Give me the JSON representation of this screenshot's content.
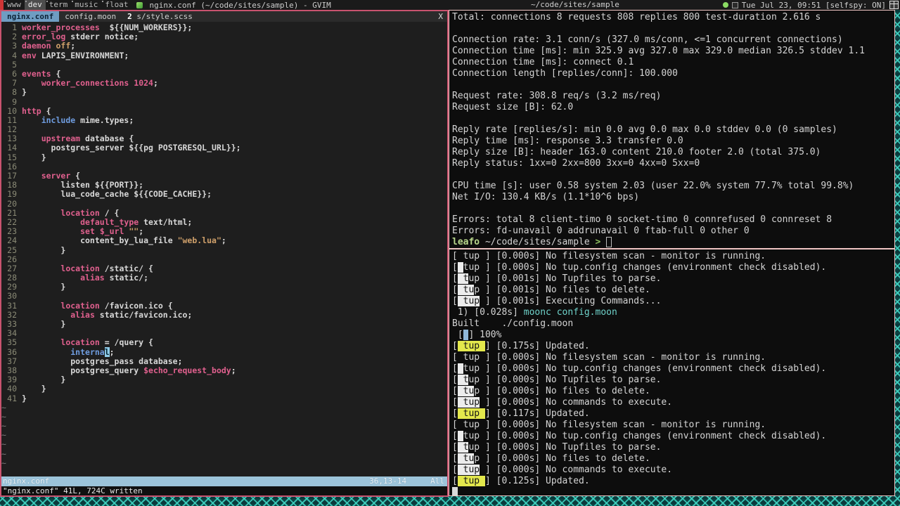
{
  "bar": {
    "tags": [
      {
        "label": "www",
        "selected": false,
        "indicator": true
      },
      {
        "label": "dev",
        "selected": true,
        "indicator": true
      },
      {
        "label": "term",
        "selected": false,
        "indicator": true
      },
      {
        "label": "music",
        "selected": false,
        "indicator": true
      },
      {
        "label": "float",
        "selected": false,
        "indicator": true
      }
    ],
    "window_title": "nginx.conf (~/code/sites/sample) - GVIM",
    "status_path": "~/code/sites/sample",
    "clock": "Tue Jul 23, 09:51 [selfspy: ON]",
    "icons": {
      "app": "gvim-icon",
      "dot": "green-dot-icon",
      "square": "hollow-square-icon",
      "grid": "grid-icon"
    },
    "accent_color": "#cf3535"
  },
  "vim": {
    "tabs": [
      {
        "label": "nginx.conf",
        "count": "",
        "active": true
      },
      {
        "label": "config.moon",
        "count": "",
        "active": false
      },
      {
        "label": "s/style.scss",
        "count": "2",
        "active": false
      }
    ],
    "close_label": "X",
    "lines": [
      {
        "n": "1",
        "seg": [
          [
            "k",
            "worker_processes"
          ],
          [
            "v",
            "  ${{NUM_WORKERS}};"
          ]
        ]
      },
      {
        "n": "2",
        "seg": [
          [
            "k",
            "error_log"
          ],
          [
            "v",
            " stderr notice;"
          ]
        ]
      },
      {
        "n": "3",
        "seg": [
          [
            "k",
            "daemon"
          ],
          [
            "v",
            " "
          ],
          [
            "s",
            "off"
          ],
          [
            "v",
            ";"
          ]
        ]
      },
      {
        "n": "4",
        "seg": [
          [
            "k",
            "env"
          ],
          [
            "v",
            " LAPIS_ENVIRONMENT;"
          ]
        ]
      },
      {
        "n": "5",
        "seg": []
      },
      {
        "n": "6",
        "seg": [
          [
            "kb",
            "events"
          ],
          [
            "v",
            " {"
          ]
        ]
      },
      {
        "n": "7",
        "seg": [
          [
            "v",
            "    "
          ],
          [
            "k",
            "worker_connections"
          ],
          [
            "v",
            " "
          ],
          [
            "k",
            "1024"
          ],
          [
            "v",
            ";"
          ]
        ]
      },
      {
        "n": "8",
        "seg": [
          [
            "v",
            "}"
          ]
        ]
      },
      {
        "n": "9",
        "seg": []
      },
      {
        "n": "10",
        "seg": [
          [
            "kb",
            "http"
          ],
          [
            "v",
            " {"
          ]
        ]
      },
      {
        "n": "11",
        "seg": [
          [
            "v",
            "    "
          ],
          [
            "b",
            "include"
          ],
          [
            "v",
            " mime.types;"
          ]
        ]
      },
      {
        "n": "12",
        "seg": []
      },
      {
        "n": "13",
        "seg": [
          [
            "v",
            "    "
          ],
          [
            "kb",
            "upstream"
          ],
          [
            "v",
            " database {"
          ]
        ]
      },
      {
        "n": "14",
        "seg": [
          [
            "v",
            "      postgres_server ${{pg POSTGRESQL_URL}};"
          ]
        ]
      },
      {
        "n": "15",
        "seg": [
          [
            "v",
            "    }"
          ]
        ]
      },
      {
        "n": "16",
        "seg": []
      },
      {
        "n": "17",
        "seg": [
          [
            "v",
            "    "
          ],
          [
            "kb",
            "server"
          ],
          [
            "v",
            " {"
          ]
        ]
      },
      {
        "n": "18",
        "seg": [
          [
            "v",
            "        listen ${{PORT}};"
          ]
        ]
      },
      {
        "n": "19",
        "seg": [
          [
            "v",
            "        lua_code_cache ${{CODE_CACHE}};"
          ]
        ]
      },
      {
        "n": "20",
        "seg": []
      },
      {
        "n": "21",
        "seg": [
          [
            "v",
            "        "
          ],
          [
            "kb",
            "location"
          ],
          [
            "v",
            " / {"
          ]
        ]
      },
      {
        "n": "22",
        "seg": [
          [
            "v",
            "            "
          ],
          [
            "k",
            "default_type"
          ],
          [
            "v",
            " text/html;"
          ]
        ]
      },
      {
        "n": "23",
        "seg": [
          [
            "v",
            "            "
          ],
          [
            "kb",
            "set"
          ],
          [
            "v",
            " "
          ],
          [
            "k",
            "$_url"
          ],
          [
            "v",
            " "
          ],
          [
            "s",
            "\"\""
          ],
          [
            "v",
            ";"
          ]
        ]
      },
      {
        "n": "24",
        "seg": [
          [
            "v",
            "            content_by_lua_file "
          ],
          [
            "s",
            "\"web.lua\""
          ],
          [
            "v",
            ";"
          ]
        ]
      },
      {
        "n": "25",
        "seg": [
          [
            "v",
            "        }"
          ]
        ]
      },
      {
        "n": "26",
        "seg": []
      },
      {
        "n": "27",
        "seg": [
          [
            "v",
            "        "
          ],
          [
            "kb",
            "location"
          ],
          [
            "v",
            " /static/ {"
          ]
        ]
      },
      {
        "n": "28",
        "seg": [
          [
            "v",
            "            "
          ],
          [
            "k",
            "alias"
          ],
          [
            "v",
            " static/;"
          ]
        ]
      },
      {
        "n": "29",
        "seg": [
          [
            "v",
            "        }"
          ]
        ]
      },
      {
        "n": "30",
        "seg": []
      },
      {
        "n": "31",
        "seg": [
          [
            "v",
            "        "
          ],
          [
            "kb",
            "location"
          ],
          [
            "v",
            " /favicon.ico {"
          ]
        ]
      },
      {
        "n": "32",
        "seg": [
          [
            "v",
            "          "
          ],
          [
            "k",
            "alias"
          ],
          [
            "v",
            " static/favicon.ico;"
          ]
        ]
      },
      {
        "n": "33",
        "seg": [
          [
            "v",
            "        }"
          ]
        ]
      },
      {
        "n": "34",
        "seg": []
      },
      {
        "n": "35",
        "seg": [
          [
            "v",
            "        "
          ],
          [
            "kb",
            "location"
          ],
          [
            "v",
            " = /query {"
          ]
        ]
      },
      {
        "n": "36",
        "seg": [
          [
            "v",
            "          "
          ],
          [
            "b",
            "interna"
          ],
          [
            "cur",
            "l"
          ],
          [
            "v",
            ";"
          ]
        ]
      },
      {
        "n": "37",
        "seg": [
          [
            "v",
            "          postgres_pass database;"
          ]
        ]
      },
      {
        "n": "38",
        "seg": [
          [
            "v",
            "          postgres_query "
          ],
          [
            "k",
            "$echo_request_body"
          ],
          [
            "v",
            ";"
          ]
        ]
      },
      {
        "n": "39",
        "seg": [
          [
            "v",
            "        }"
          ]
        ]
      },
      {
        "n": "40",
        "seg": [
          [
            "v",
            "    }"
          ]
        ]
      },
      {
        "n": "41",
        "seg": [
          [
            "v",
            "}"
          ]
        ]
      }
    ],
    "tilde_rows": 7,
    "tilde_char": "~",
    "statusline": {
      "file": "nginx.conf",
      "position": "36,13-14",
      "scroll": "All"
    },
    "cmdline": "\"nginx.conf\" 41L, 724C written"
  },
  "term_top": {
    "lines": [
      {
        "seg": [
          [
            "w",
            "Total: connections 8 requests 808 replies 800 test-duration 2.616 s"
          ]
        ]
      },
      {
        "seg": []
      },
      {
        "seg": [
          [
            "w",
            "Connection rate: 3.1 conn/s (327.0 ms/conn, <=1 concurrent connections)"
          ]
        ]
      },
      {
        "seg": [
          [
            "w",
            "Connection time [ms]: min 325.9 avg 327.0 max 329.0 median 326.5 stddev 1.1"
          ]
        ]
      },
      {
        "seg": [
          [
            "w",
            "Connection time [ms]: connect 0.1"
          ]
        ]
      },
      {
        "seg": [
          [
            "w",
            "Connection length [replies/conn]: 100.000"
          ]
        ]
      },
      {
        "seg": []
      },
      {
        "seg": [
          [
            "w",
            "Request rate: 308.8 req/s (3.2 ms/req)"
          ]
        ]
      },
      {
        "seg": [
          [
            "w",
            "Request size [B]: 62.0"
          ]
        ]
      },
      {
        "seg": []
      },
      {
        "seg": [
          [
            "w",
            "Reply rate [replies/s]: min 0.0 avg 0.0 max 0.0 stddev 0.0 (0 samples)"
          ]
        ]
      },
      {
        "seg": [
          [
            "w",
            "Reply time [ms]: response 3.3 transfer 0.0"
          ]
        ]
      },
      {
        "seg": [
          [
            "w",
            "Reply size [B]: header 163.0 content 210.0 footer 2.0 (total 375.0)"
          ]
        ]
      },
      {
        "seg": [
          [
            "w",
            "Reply status: 1xx=0 2xx=800 3xx=0 4xx=0 5xx=0"
          ]
        ]
      },
      {
        "seg": []
      },
      {
        "seg": [
          [
            "w",
            "CPU time [s]: user 0.58 system 2.03 (user 22.0% system 77.7% total 99.8%)"
          ]
        ]
      },
      {
        "seg": [
          [
            "w",
            "Net I/O: 130.4 KB/s (1.1*10^6 bps)"
          ]
        ]
      },
      {
        "seg": []
      },
      {
        "seg": [
          [
            "w",
            "Errors: total 8 client-timo 0 socket-timo 0 connrefused 0 connreset 8"
          ]
        ]
      },
      {
        "seg": [
          [
            "w",
            "Errors: fd-unavail 0 addrunavail 0 ftab-full 0 other 0"
          ]
        ]
      },
      {
        "seg": [
          [
            "green",
            "leafo "
          ],
          [
            "w",
            "~/code/sites/sample "
          ],
          [
            "gt",
            "> "
          ],
          [
            "hcur",
            " "
          ]
        ]
      }
    ]
  },
  "term_bottom": {
    "lines": [
      {
        "seg": [
          [
            "w",
            "[ tup ] [0.000s] No filesystem scan - monitor is running."
          ]
        ]
      },
      {
        "seg": [
          [
            "w",
            "["
          ],
          [
            "hl",
            " "
          ],
          [
            "w",
            "tup ] [0.000s] No tup.config changes (environment check disabled)."
          ]
        ]
      },
      {
        "seg": [
          [
            "w",
            "["
          ],
          [
            "hl",
            " t"
          ],
          [
            "w",
            "up ] [0.001s] No Tupfiles to parse."
          ]
        ]
      },
      {
        "seg": [
          [
            "w",
            "["
          ],
          [
            "hl",
            " tu"
          ],
          [
            "w",
            "p ] [0.001s] No files to delete."
          ]
        ]
      },
      {
        "seg": [
          [
            "w",
            "["
          ],
          [
            "hl",
            " tup"
          ],
          [
            "w",
            " ] [0.001s] Executing Commands..."
          ]
        ]
      },
      {
        "seg": [
          [
            "w",
            " 1) [0.028s] "
          ],
          [
            "cy",
            "moonc config.moon"
          ]
        ]
      },
      {
        "seg": [
          [
            "w",
            "Built    ./config.moon"
          ]
        ]
      },
      {
        "seg": [
          [
            "w",
            " ["
          ],
          [
            "bb",
            " "
          ],
          [
            "w",
            "] 100%"
          ]
        ]
      },
      {
        "seg": [
          [
            "w",
            "["
          ],
          [
            "yl",
            " tup "
          ],
          [
            "w",
            "] [0.175s] Updated."
          ]
        ]
      },
      {
        "seg": [
          [
            "w",
            "[ tup ] [0.000s] No filesystem scan - monitor is running."
          ]
        ]
      },
      {
        "seg": [
          [
            "w",
            "["
          ],
          [
            "hl",
            " "
          ],
          [
            "w",
            "tup ] [0.000s] No tup.config changes (environment check disabled)."
          ]
        ]
      },
      {
        "seg": [
          [
            "w",
            "["
          ],
          [
            "hl",
            " t"
          ],
          [
            "w",
            "up ] [0.000s] No Tupfiles to parse."
          ]
        ]
      },
      {
        "seg": [
          [
            "w",
            "["
          ],
          [
            "hl",
            " tu"
          ],
          [
            "w",
            "p ] [0.000s] No files to delete."
          ]
        ]
      },
      {
        "seg": [
          [
            "w",
            "["
          ],
          [
            "hl",
            " tup"
          ],
          [
            "w",
            " ] [0.000s] No commands to execute."
          ]
        ]
      },
      {
        "seg": [
          [
            "w",
            "["
          ],
          [
            "yl",
            " tup "
          ],
          [
            "w",
            "] [0.117s] Updated."
          ]
        ]
      },
      {
        "seg": [
          [
            "w",
            "[ tup ] [0.000s] No filesystem scan - monitor is running."
          ]
        ]
      },
      {
        "seg": [
          [
            "w",
            "["
          ],
          [
            "hl",
            " "
          ],
          [
            "w",
            "tup ] [0.000s] No tup.config changes (environment check disabled)."
          ]
        ]
      },
      {
        "seg": [
          [
            "w",
            "["
          ],
          [
            "hl",
            " t"
          ],
          [
            "w",
            "up ] [0.000s] No Tupfiles to parse."
          ]
        ]
      },
      {
        "seg": [
          [
            "w",
            "["
          ],
          [
            "hl",
            " tu"
          ],
          [
            "w",
            "p ] [0.000s] No files to delete."
          ]
        ]
      },
      {
        "seg": [
          [
            "w",
            "["
          ],
          [
            "hl",
            " tup"
          ],
          [
            "w",
            " ] [0.000s] No commands to execute."
          ]
        ]
      },
      {
        "seg": [
          [
            "w",
            "["
          ],
          [
            "yl",
            " tup "
          ],
          [
            "w",
            "] [0.125s] Updated."
          ]
        ]
      },
      {
        "seg": [
          [
            "cb",
            " "
          ]
        ]
      }
    ]
  }
}
